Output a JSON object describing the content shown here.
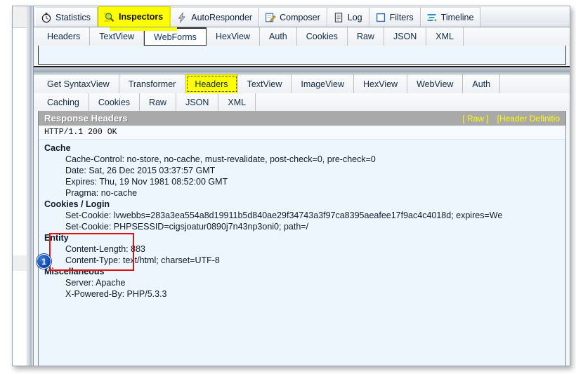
{
  "window": {
    "top_tabs": [
      {
        "label": "Statistics",
        "icon": "stopwatch-icon",
        "active": false
      },
      {
        "label": "Inspectors",
        "icon": "magnifier-icon",
        "active": true
      },
      {
        "label": "AutoResponder",
        "icon": "lightning-icon",
        "active": false
      },
      {
        "label": "Composer",
        "icon": "pencil-note-icon",
        "active": false
      },
      {
        "label": "Log",
        "icon": "document-icon",
        "active": false
      },
      {
        "label": "Filters",
        "icon": "square-outline-icon",
        "active": false
      },
      {
        "label": "Timeline",
        "icon": "timeline-bars-icon",
        "active": false
      }
    ]
  },
  "request_tabs": [
    {
      "label": "Headers",
      "state": "normal"
    },
    {
      "label": "TextView",
      "state": "normal"
    },
    {
      "label": "WebForms",
      "state": "selected"
    },
    {
      "label": "HexView",
      "state": "normal"
    },
    {
      "label": "Auth",
      "state": "normal"
    },
    {
      "label": "Cookies",
      "state": "normal"
    },
    {
      "label": "Raw",
      "state": "normal"
    },
    {
      "label": "JSON",
      "state": "normal"
    },
    {
      "label": "XML",
      "state": "normal"
    }
  ],
  "response_tabs_row1": [
    {
      "label": "Get SyntaxView",
      "state": "normal"
    },
    {
      "label": "Transformer",
      "state": "normal"
    },
    {
      "label": "Headers",
      "state": "highlighted"
    },
    {
      "label": "TextView",
      "state": "normal"
    },
    {
      "label": "ImageView",
      "state": "normal"
    },
    {
      "label": "HexView",
      "state": "normal"
    },
    {
      "label": "WebView",
      "state": "normal"
    },
    {
      "label": "Auth",
      "state": "normal"
    }
  ],
  "response_tabs_row2": [
    {
      "label": "Caching",
      "state": "normal"
    },
    {
      "label": "Cookies",
      "state": "normal"
    },
    {
      "label": "Raw",
      "state": "normal"
    },
    {
      "label": "JSON",
      "state": "normal"
    },
    {
      "label": "XML",
      "state": "normal"
    }
  ],
  "response_panel": {
    "title": "Response Headers",
    "link_raw": "[ Raw ]",
    "link_header_definitions": "[Header Definitio",
    "status_line": "HTTP/1.1 200 OK",
    "groups": [
      {
        "name": "Cache",
        "rows": [
          "Cache-Control: no-store, no-cache, must-revalidate, post-check=0, pre-check=0",
          "Date: Sat, 26 Dec 2015 03:37:57 GMT",
          "Expires: Thu, 19 Nov 1981 08:52:00 GMT",
          "Pragma: no-cache"
        ]
      },
      {
        "name": "Cookies / Login",
        "rows": [
          "Set-Cookie: lvwebbs=283a3ea554a8d19911b5d840ae29f34743a3f97ca8395aeafee17f9ac4c4018d; expires=We",
          "Set-Cookie: PHPSESSID=cigsjoatur0890j7n43np3oni0; path=/"
        ]
      },
      {
        "name": "Entity",
        "rows": [
          "Content-Length: 883",
          "Content-Type: text/html; charset=UTF-8"
        ]
      },
      {
        "name": "Miscellaneous",
        "rows": [
          "Server: Apache",
          "X-Powered-By: PHP/5.3.3"
        ]
      }
    ]
  },
  "annotations": {
    "callout_number": "1",
    "highlight_color": "#ffff00",
    "box_color": "#e01111",
    "badge_color": "#0b3fa8"
  }
}
